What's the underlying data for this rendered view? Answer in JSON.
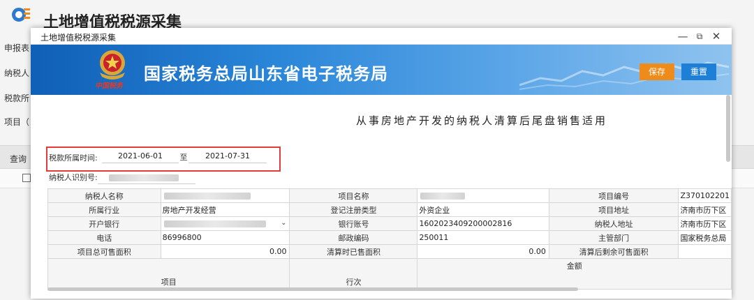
{
  "background": {
    "title": "土地增值税税源采集",
    "labels": [
      "申报表",
      "纳税人",
      "税款所",
      "项目（"
    ],
    "query_label": "查询"
  },
  "modal": {
    "title": "土地增值税税源采集",
    "win": {
      "min": "—",
      "max": "⧉",
      "close": "✕"
    }
  },
  "banner": {
    "title": "国家税务总局山东省电子税务局",
    "emblem_caption": "中国税务",
    "save": "保存",
    "reset": "重置"
  },
  "form": {
    "heading": "从事房地产开发的纳税人清算后尾盘销售适用",
    "period_label": "税款所属时间:",
    "period_from": "2021-06-01",
    "period_sep": "至",
    "period_to": "2021-07-31",
    "taxid_label": "纳税人识别号:"
  },
  "table": {
    "r1": {
      "l1": "纳税人名称",
      "l2": "项目名称",
      "l3": "项目编号",
      "v3": "Z370102201"
    },
    "r2": {
      "l1": "所属行业",
      "v1": "房地产开发经营",
      "l2": "登记注册类型",
      "v2": "外资企业",
      "l3": "项目地址",
      "v3": "济南市历下区"
    },
    "r3": {
      "l1": "开户银行",
      "l2": "银行账号",
      "v2": "1602023409200002816",
      "l3": "纳税人地址",
      "v3": "济南市历下区"
    },
    "r4": {
      "l1": "电话",
      "v1": "86996800",
      "l2": "邮政编码",
      "v2": "250011",
      "l3": "主管部门",
      "v3": "国家税务总局"
    },
    "r5": {
      "l1": "项目总可售面积",
      "v1": "0.00",
      "l2": "清算时已售面积",
      "v2": "0.00",
      "l3": "清算后剩余可售面积"
    },
    "r6": {
      "c1": "项目",
      "c2": "行次",
      "c3": "金额"
    }
  },
  "colors": {
    "save": "#ef8b1a",
    "reset": "#1e7fd6",
    "highlight": "#e13b3b",
    "banner": "#0f5fb6"
  }
}
